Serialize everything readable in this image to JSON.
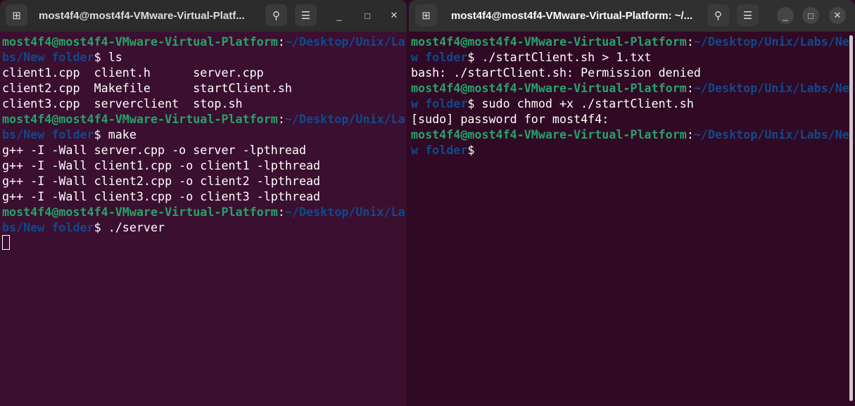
{
  "left": {
    "title": "most4f4@most4f4-VMware-Virtual-Platf...",
    "lines": [
      [
        [
          "g",
          "most4f4@most4f4-VMware-Virtual-Platform"
        ],
        [
          "w",
          ":"
        ],
        [
          "b",
          "~/Desktop/Unix/La"
        ]
      ],
      [
        [
          "b",
          "bs/New folder"
        ],
        [
          "w",
          "$ ls"
        ]
      ],
      [
        [
          "w",
          "client1.cpp  client.h      server.cpp"
        ]
      ],
      [
        [
          "w",
          "client2.cpp  Makefile      startClient.sh"
        ]
      ],
      [
        [
          "w",
          "client3.cpp  serverclient  stop.sh"
        ]
      ],
      [
        [
          "g",
          "most4f4@most4f4-VMware-Virtual-Platform"
        ],
        [
          "w",
          ":"
        ],
        [
          "b",
          "~/Desktop/Unix/La"
        ]
      ],
      [
        [
          "b",
          "bs/New folder"
        ],
        [
          "w",
          "$ make"
        ]
      ],
      [
        [
          "w",
          "g++ -I -Wall server.cpp -o server -lpthread"
        ]
      ],
      [
        [
          "w",
          "g++ -I -Wall client1.cpp -o client1 -lpthread"
        ]
      ],
      [
        [
          "w",
          "g++ -I -Wall client2.cpp -o client2 -lpthread"
        ]
      ],
      [
        [
          "w",
          "g++ -I -Wall client3.cpp -o client3 -lpthread"
        ]
      ],
      [
        [
          "g",
          "most4f4@most4f4-VMware-Virtual-Platform"
        ],
        [
          "w",
          ":"
        ],
        [
          "b",
          "~/Desktop/Unix/La"
        ]
      ],
      [
        [
          "b",
          "bs/New folder"
        ],
        [
          "w",
          "$ ./server"
        ]
      ]
    ]
  },
  "right": {
    "title": "most4f4@most4f4-VMware-Virtual-Platform: ~/...",
    "lines": [
      [
        [
          "g",
          "most4f4@most4f4-VMware-Virtual-Platform"
        ],
        [
          "w",
          ":"
        ],
        [
          "b",
          "~/Desktop/Unix/Labs/Ne"
        ]
      ],
      [
        [
          "b",
          "w folder"
        ],
        [
          "w",
          "$ ./startClient.sh > 1.txt"
        ]
      ],
      [
        [
          "w",
          "bash: ./startClient.sh: Permission denied"
        ]
      ],
      [
        [
          "g",
          "most4f4@most4f4-VMware-Virtual-Platform"
        ],
        [
          "w",
          ":"
        ],
        [
          "b",
          "~/Desktop/Unix/Labs/Ne"
        ]
      ],
      [
        [
          "b",
          "w folder"
        ],
        [
          "w",
          "$ sudo chmod +x ./startClient.sh"
        ]
      ],
      [
        [
          "w",
          "[sudo] password for most4f4:"
        ]
      ],
      [
        [
          "g",
          "most4f4@most4f4-VMware-Virtual-Platform"
        ],
        [
          "w",
          ":"
        ],
        [
          "b",
          "~/Desktop/Unix/Labs/Ne"
        ]
      ],
      [
        [
          "b",
          "w folder"
        ],
        [
          "w",
          "$"
        ]
      ]
    ]
  }
}
